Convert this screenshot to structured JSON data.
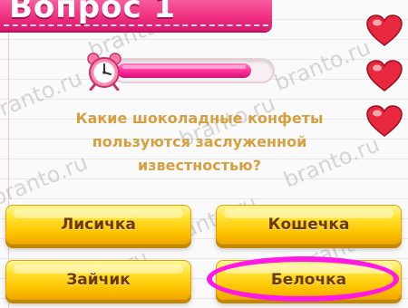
{
  "header": {
    "title": "Вопрос 1"
  },
  "timer": {
    "remaining_fraction": 0.88
  },
  "lives": {
    "count": 3,
    "icon": "heart-icon",
    "color": "#e8283f"
  },
  "question": {
    "line1": "Какие шоколадные конфеты",
    "line2": "пользуются заслуженной",
    "line3": "известностью?"
  },
  "answers": [
    {
      "label": "Лисичка"
    },
    {
      "label": "Кошечка"
    },
    {
      "label": "Зайчик"
    },
    {
      "label": "Белочка",
      "highlighted": true
    }
  ],
  "watermark": {
    "text": "branto.ru"
  },
  "colors": {
    "banner": "#ee2d7e",
    "timer_fill": "#ff2c98",
    "question_text": "#d6a040",
    "answer_button": "#ffd21a",
    "highlight_ring": "#ff18e6"
  }
}
